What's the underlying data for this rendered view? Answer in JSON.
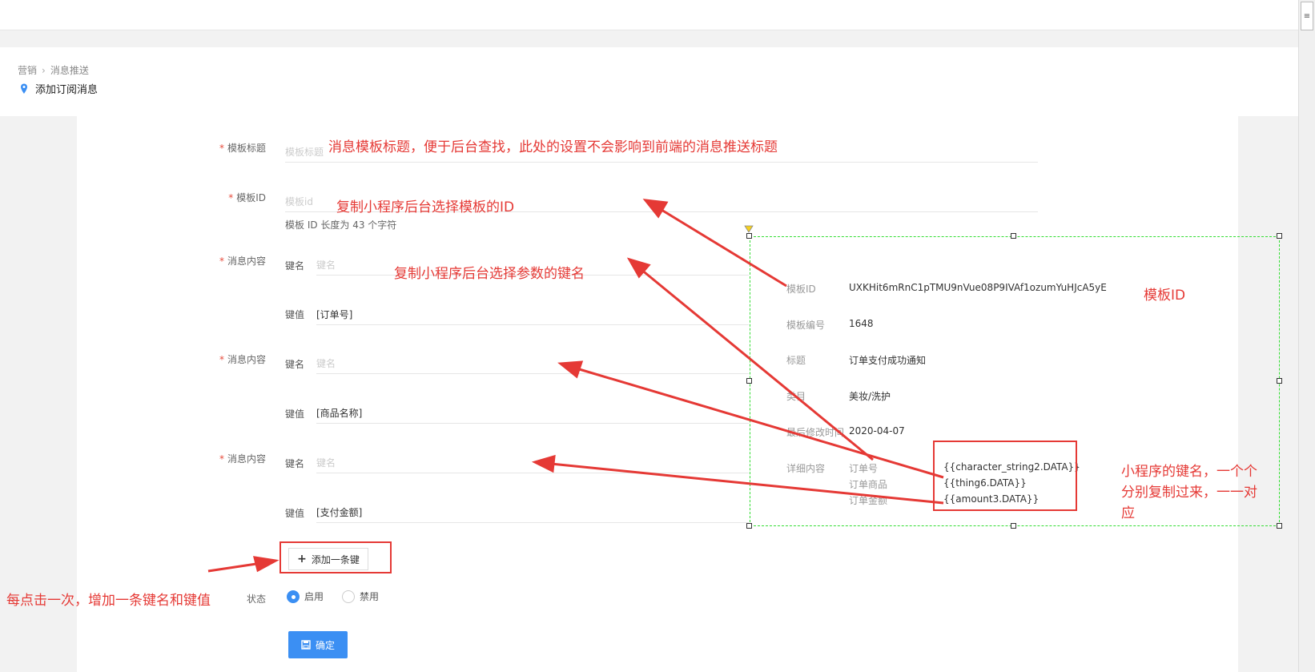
{
  "breadcrumb": {
    "root": "营销",
    "current": "消息推送"
  },
  "page_title": "添加订阅消息",
  "form": {
    "template_title_label": "模板标题",
    "template_title_placeholder": "模板标题",
    "template_id_label": "模板ID",
    "template_id_placeholder": "模板id",
    "template_id_hint": "模板 ID 长度为 43 个字符",
    "content_label": "消息内容",
    "key_label": "键名",
    "value_label": "键值",
    "key_placeholder": "键名",
    "rows": [
      {
        "value": "[订单号]"
      },
      {
        "value": "[商品名称]"
      },
      {
        "value": "[支付金额]"
      }
    ],
    "add_button": "添加一条键",
    "status_label": "状态",
    "status_on": "启用",
    "status_off": "禁用",
    "submit_button": "确定"
  },
  "template_panel": {
    "id_label": "模板ID",
    "id_value": "UXKHit6mRnC1pTMU9nVue08P9IVAf1ozumYuHJcA5yE",
    "number_label": "模板编号",
    "number_value": "1648",
    "title_label": "标题",
    "title_value": "订单支付成功通知",
    "category_label": "类目",
    "category_value": "美妆/洗护",
    "modified_label": "最后修改时间",
    "modified_value": "2020-04-07",
    "detail_label": "详细内容",
    "details": [
      {
        "name": "订单号",
        "key": "{{character_string2.DATA}}"
      },
      {
        "name": "订单商品",
        "key": "{{thing6.DATA}}"
      },
      {
        "name": "订单金额",
        "key": "{{amount3.DATA}}"
      }
    ]
  },
  "annotations": {
    "title_note": "消息模板标题，便于后台查找，此处的设置不会影响到前端的消息推送标题",
    "id_note": "复制小程序后台选择模板的ID",
    "key_note": "复制小程序后台选择参数的键名",
    "template_id_note": "模板ID",
    "keys_note_line1": "小程序的键名，一个个",
    "keys_note_line2": "分别复制过来，一一对",
    "keys_note_line3": "应",
    "add_note": "每点击一次，增加一条键名和键值"
  },
  "colors": {
    "accent": "#3b8ff3",
    "annotation": "#e53935",
    "required": "#e74c3c",
    "selection": "#33dd33"
  }
}
